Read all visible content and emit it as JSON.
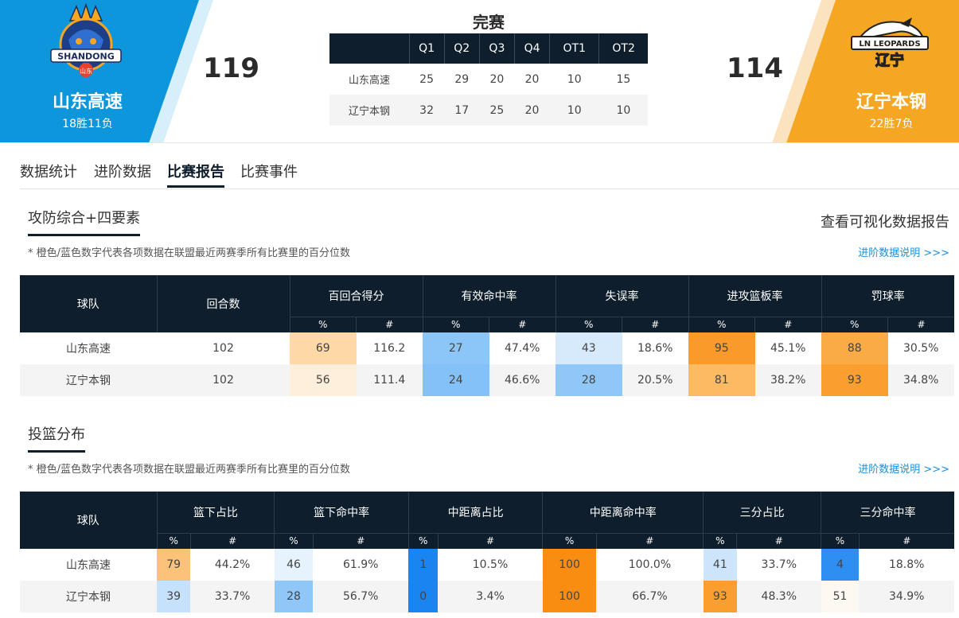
{
  "header": {
    "status": "完赛",
    "home": {
      "name": "山东高速",
      "record": "18胜11负",
      "score": "119",
      "logo_text": "SHANDONG",
      "logo_sub": "山东",
      "color": "#0e96dc"
    },
    "away": {
      "name": "辽宁本钢",
      "record": "22胜7负",
      "score": "114",
      "logo_text": "LN LEOPARDS",
      "logo_sub": "辽宁",
      "color": "#f5a623"
    },
    "quarters": {
      "headers": [
        "Q1",
        "Q2",
        "Q3",
        "Q4",
        "OT1",
        "OT2"
      ],
      "rows": [
        {
          "team": "山东高速",
          "scores": [
            "25",
            "29",
            "20",
            "20",
            "10",
            "15"
          ]
        },
        {
          "team": "辽宁本钢",
          "scores": [
            "32",
            "17",
            "25",
            "20",
            "10",
            "10"
          ]
        }
      ]
    }
  },
  "tabs": [
    {
      "label": "数据统计",
      "active": false
    },
    {
      "label": "进阶数据",
      "active": false
    },
    {
      "label": "比赛报告",
      "active": true
    },
    {
      "label": "比赛事件",
      "active": false
    }
  ],
  "view_visual_report": "查看可视化数据报告",
  "sections": [
    {
      "title": "攻防综合+四要素",
      "note": "* 橙色/蓝色数字代表各项数据在联盟最近两赛季所有比赛里的百分位数",
      "explain_link": "进阶数据说明 >>>",
      "team_header": "球队",
      "extra_header": "回合数",
      "groups": [
        "百回合得分",
        "有效命中率",
        "失误率",
        "进攻篮板率",
        "罚球率"
      ],
      "sub_headers": [
        "%",
        "#"
      ],
      "rows": [
        {
          "team": "山东高速",
          "extra": "102",
          "cells": [
            {
              "pct": "69",
              "val": "116.2",
              "bg": "#fdd9a8"
            },
            {
              "pct": "27",
              "val": "47.4%",
              "bg": "#8cc6f8"
            },
            {
              "pct": "43",
              "val": "18.6%",
              "bg": "#d6eafc"
            },
            {
              "pct": "95",
              "val": "45.1%",
              "bg": "#f99a2a"
            },
            {
              "pct": "88",
              "val": "30.5%",
              "bg": "#fbab45"
            }
          ]
        },
        {
          "team": "辽宁本钢",
          "extra": "102",
          "cells": [
            {
              "pct": "56",
              "val": "111.4",
              "bg": "#fdefdc"
            },
            {
              "pct": "24",
              "val": "46.6%",
              "bg": "#83c1f8"
            },
            {
              "pct": "28",
              "val": "20.5%",
              "bg": "#8ec7f8"
            },
            {
              "pct": "81",
              "val": "38.2%",
              "bg": "#fcbb63"
            },
            {
              "pct": "93",
              "val": "34.8%",
              "bg": "#fa9e30"
            }
          ]
        }
      ]
    },
    {
      "title": "投篮分布",
      "note": "* 橙色/蓝色数字代表各项数据在联盟最近两赛季所有比赛里的百分位数",
      "explain_link": "进阶数据说明 >>>",
      "team_header": "球队",
      "groups": [
        "篮下占比",
        "篮下命中率",
        "中距离占比",
        "中距离命中率",
        "三分占比",
        "三分命中率"
      ],
      "sub_headers": [
        "%",
        "#"
      ],
      "rows": [
        {
          "team": "山东高速",
          "cells": [
            {
              "pct": "79",
              "val": "44.2%",
              "bg": "#fcc27a"
            },
            {
              "pct": "46",
              "val": "61.9%",
              "bg": "#e6f2fd"
            },
            {
              "pct": "1",
              "val": "10.5%",
              "bg": "#1a84f0"
            },
            {
              "pct": "100",
              "val": "100.0%",
              "bg": "#f98d12"
            },
            {
              "pct": "41",
              "val": "33.7%",
              "bg": "#cde5fb"
            },
            {
              "pct": "4",
              "val": "18.8%",
              "bg": "#2e8ef2"
            }
          ]
        },
        {
          "team": "辽宁本钢",
          "cells": [
            {
              "pct": "39",
              "val": "33.7%",
              "bg": "#c5e1fb"
            },
            {
              "pct": "28",
              "val": "56.7%",
              "bg": "#8ec7f8"
            },
            {
              "pct": "0",
              "val": "3.4%",
              "bg": "#1a84f0"
            },
            {
              "pct": "100",
              "val": "66.7%",
              "bg": "#f98d12"
            },
            {
              "pct": "93",
              "val": "48.3%",
              "bg": "#fa9e30"
            },
            {
              "pct": "51",
              "val": "34.9%",
              "bg": "#fdf9f2"
            }
          ]
        }
      ]
    }
  ]
}
